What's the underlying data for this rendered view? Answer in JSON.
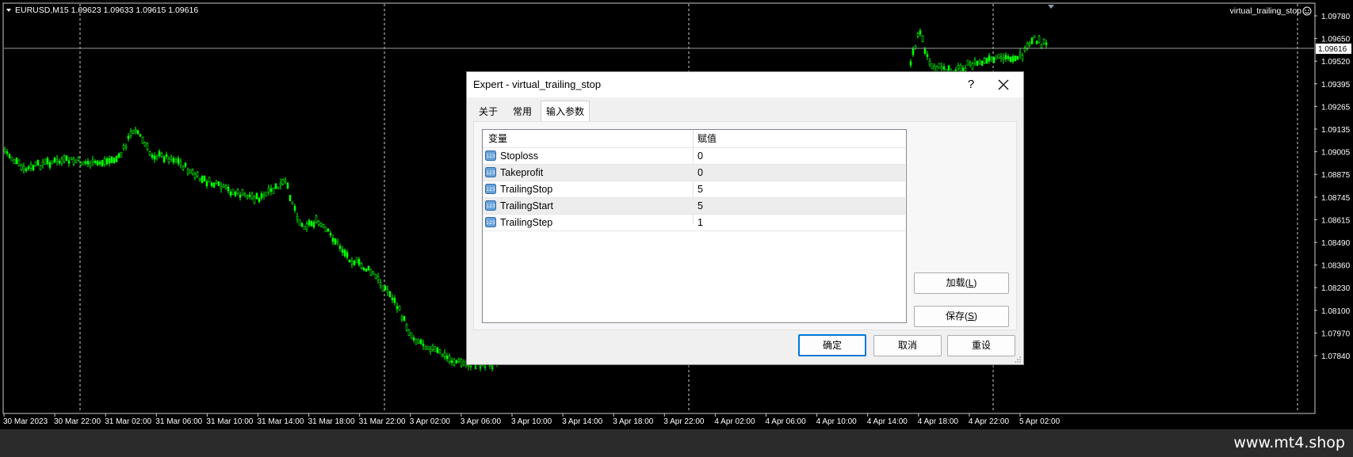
{
  "chart": {
    "header": "EURUSD,M15  1.09623 1.09633 1.09615 1.09616",
    "indicator_label": "virtual_trailing_stop",
    "current_price_tag": "1.09616",
    "price_ticks": [
      "1.09780",
      "1.09650",
      "1.09520",
      "1.09395",
      "1.09265",
      "1.09135",
      "1.09005",
      "1.08875",
      "1.08745",
      "1.08615",
      "1.08490",
      "1.08360",
      "1.08230",
      "1.08100",
      "1.07970",
      "1.07840"
    ],
    "time_ticks": [
      "30 Mar 2023",
      "30 Mar 22:00",
      "31 Mar 02:00",
      "31 Mar 06:00",
      "31 Mar 10:00",
      "31 Mar 14:00",
      "31 Mar 18:00",
      "31 Mar 22:00",
      "3 Apr 02:00",
      "3 Apr 06:00",
      "3 Apr 10:00",
      "3 Apr 14:00",
      "3 Apr 18:00",
      "3 Apr 22:00",
      "4 Apr 02:00",
      "4 Apr 06:00",
      "4 Apr 10:00",
      "4 Apr 14:00",
      "4 Apr 18:00",
      "4 Apr 22:00",
      "5 Apr 02:00"
    ],
    "candle_color": "#00ff00",
    "background": "#000000"
  },
  "dialog": {
    "title": "Expert - virtual_trailing_stop",
    "help": "?",
    "tabs": [
      "关于",
      "常用",
      "输入参数"
    ],
    "active_tab": "输入参数",
    "columns": [
      "变量",
      "赋值"
    ],
    "params": [
      {
        "name": "Stoploss",
        "value": "0"
      },
      {
        "name": "Takeprofit",
        "value": "0"
      },
      {
        "name": "TrailingStop",
        "value": "5"
      },
      {
        "name": "TrailingStart",
        "value": "5"
      },
      {
        "name": "TrailingStep",
        "value": "1"
      }
    ],
    "load_label": "加载(",
    "load_key": "L",
    "save_label": "保存(",
    "save_key": "S",
    "paren_close": ")",
    "ok_label": "确定",
    "cancel_label": "取消",
    "reset_label": "重设"
  },
  "footer": {
    "site": "www.mt4.shop"
  }
}
